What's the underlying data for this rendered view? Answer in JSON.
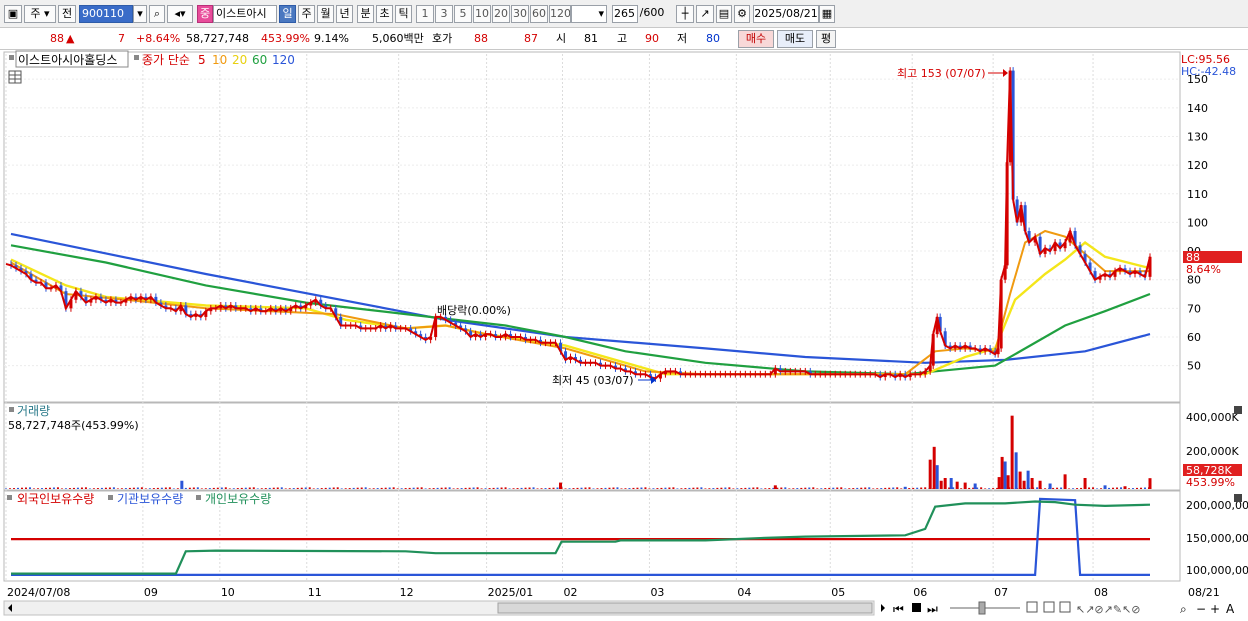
{
  "toolbar": {
    "period_type": "주",
    "prev_label": "전",
    "stock_code": "900110",
    "stock_name": "이스트아시",
    "badge": "중",
    "timeframes": [
      "일",
      "주",
      "월",
      "년",
      "분",
      "초",
      "틱"
    ],
    "selected_timeframe": "일",
    "numbers": [
      "1",
      "3",
      "5",
      "10",
      "20",
      "30",
      "60",
      "120"
    ],
    "count": "265",
    "count_max": "/600",
    "date": "2025/08/21"
  },
  "quote": {
    "price": "88",
    "change": "7",
    "change_pct": "+8.64%",
    "volume": "58,727,748",
    "volume_pct": "453.99%",
    "turnover": "9.14%",
    "amount": "5,060백만",
    "hoga_label": "호가",
    "hoga1": "88",
    "hoga2": "87",
    "open_label": "시",
    "open": "81",
    "high_label": "고",
    "high": "90",
    "low_label": "저",
    "low": "80",
    "buy_label": "매수",
    "sell_label": "매도",
    "avg_label": "평"
  },
  "price_panel": {
    "stock_label": "이스트아시아홀딩스",
    "ma_label": "종가 단순",
    "ma_periods": [
      "5",
      "10",
      "20",
      "60",
      "120"
    ],
    "ma_colors": [
      "#d40000",
      "#f09a10",
      "#f0e020",
      "#20a040",
      "#2a55d8"
    ],
    "lc": "LC:95.56",
    "hc": "HC:-42.48",
    "max_annotation": "최고 153 (07/07)",
    "min_annotation": "최저 45 (03/07)",
    "div_annotation": "배당락(0.00%)",
    "current_price": "88",
    "current_pct": "8.64%",
    "y_ticks": [
      "150",
      "140",
      "130",
      "120",
      "110",
      "100",
      "90",
      "80",
      "70",
      "60",
      "50"
    ]
  },
  "volume_panel": {
    "title": "거래량",
    "current": "58,727,748주(453.99%)",
    "y_ticks": [
      "400,000K",
      "200,000K"
    ],
    "last_value": "58,728K",
    "last_pct": "453.99%"
  },
  "holding_panel": {
    "series": [
      {
        "name": "외국인보유수량",
        "color": "#d40000"
      },
      {
        "name": "기관보유수량",
        "color": "#2a55d8"
      },
      {
        "name": "개인보유수량",
        "color": "#20905a"
      }
    ],
    "y_ticks": [
      "200,000,00",
      "150,000,00",
      "100,000,00"
    ]
  },
  "x_axis": {
    "labels": [
      "2024/07/08",
      "09",
      "10",
      "11",
      "12",
      "2025/01",
      "02",
      "03",
      "04",
      "05",
      "06",
      "07",
      "08",
      "08/21"
    ]
  },
  "chart_data": {
    "type": "line",
    "x_range": [
      "2024/07/08",
      "2025/08/21"
    ],
    "price_ylim": [
      38,
      156
    ],
    "price_close": [
      [
        0,
        85.5
      ],
      [
        5,
        85
      ],
      [
        10,
        84
      ],
      [
        15,
        83
      ],
      [
        20,
        82
      ],
      [
        25,
        80
      ],
      [
        30,
        79
      ],
      [
        35,
        79
      ],
      [
        40,
        77
      ],
      [
        45,
        77
      ],
      [
        50,
        78
      ],
      [
        55,
        76
      ],
      [
        60,
        70
      ],
      [
        65,
        73
      ],
      [
        70,
        76
      ],
      [
        75,
        74
      ],
      [
        80,
        72
      ],
      [
        85,
        73
      ],
      [
        90,
        74
      ],
      [
        95,
        73
      ],
      [
        100,
        72
      ],
      [
        105,
        73
      ],
      [
        110,
        72
      ],
      [
        115,
        72
      ],
      [
        120,
        73
      ],
      [
        125,
        74
      ],
      [
        130,
        73
      ],
      [
        135,
        74
      ],
      [
        140,
        73
      ],
      [
        145,
        74
      ],
      [
        150,
        72
      ],
      [
        155,
        71
      ],
      [
        160,
        70
      ],
      [
        165,
        70
      ],
      [
        170,
        69
      ],
      [
        175,
        71
      ],
      [
        180,
        68
      ],
      [
        185,
        67
      ],
      [
        190,
        68
      ],
      [
        195,
        67
      ],
      [
        200,
        69
      ],
      [
        205,
        70
      ],
      [
        210,
        70
      ],
      [
        215,
        71
      ],
      [
        220,
        70
      ],
      [
        225,
        71
      ],
      [
        230,
        70
      ],
      [
        235,
        70
      ],
      [
        240,
        70
      ],
      [
        245,
        69
      ],
      [
        250,
        70
      ],
      [
        255,
        69
      ],
      [
        260,
        69
      ],
      [
        265,
        70
      ],
      [
        270,
        69
      ],
      [
        275,
        70
      ],
      [
        280,
        69
      ],
      [
        285,
        70
      ],
      [
        290,
        71
      ],
      [
        295,
        70
      ],
      [
        300,
        71
      ],
      [
        305,
        72
      ],
      [
        310,
        73
      ],
      [
        315,
        71
      ],
      [
        320,
        70
      ],
      [
        325,
        70
      ],
      [
        330,
        67
      ],
      [
        335,
        64
      ],
      [
        340,
        64
      ],
      [
        345,
        64
      ],
      [
        350,
        64
      ],
      [
        355,
        63
      ],
      [
        360,
        63
      ],
      [
        365,
        63
      ],
      [
        370,
        63
      ],
      [
        375,
        64
      ],
      [
        380,
        63
      ],
      [
        385,
        64
      ],
      [
        390,
        63
      ],
      [
        395,
        63
      ],
      [
        400,
        63
      ],
      [
        405,
        62
      ],
      [
        410,
        61
      ],
      [
        415,
        60
      ],
      [
        420,
        59
      ],
      [
        425,
        60
      ],
      [
        430,
        67
      ],
      [
        435,
        67
      ],
      [
        440,
        66
      ],
      [
        445,
        65
      ],
      [
        450,
        64
      ],
      [
        455,
        63
      ],
      [
        460,
        62
      ],
      [
        465,
        60
      ],
      [
        470,
        61
      ],
      [
        475,
        60
      ],
      [
        480,
        61
      ],
      [
        485,
        61
      ],
      [
        490,
        60
      ],
      [
        495,
        60
      ],
      [
        500,
        61
      ],
      [
        505,
        60
      ],
      [
        510,
        60
      ],
      [
        515,
        60
      ],
      [
        520,
        59
      ],
      [
        525,
        59
      ],
      [
        530,
        59
      ],
      [
        535,
        58
      ],
      [
        540,
        58
      ],
      [
        545,
        58
      ],
      [
        550,
        58
      ],
      [
        555,
        55
      ],
      [
        560,
        52
      ],
      [
        565,
        53
      ],
      [
        570,
        52
      ],
      [
        575,
        51
      ],
      [
        580,
        51
      ],
      [
        585,
        51
      ],
      [
        590,
        51
      ],
      [
        595,
        50
      ],
      [
        600,
        50
      ],
      [
        605,
        50
      ],
      [
        610,
        49
      ],
      [
        615,
        49
      ],
      [
        620,
        48
      ],
      [
        625,
        48
      ],
      [
        630,
        47
      ],
      [
        635,
        47
      ],
      [
        640,
        47
      ],
      [
        645,
        46
      ],
      [
        650,
        45.5
      ],
      [
        655,
        47
      ],
      [
        660,
        48
      ],
      [
        665,
        48
      ],
      [
        670,
        48
      ],
      [
        675,
        47
      ],
      [
        680,
        47
      ],
      [
        685,
        47
      ],
      [
        690,
        47
      ],
      [
        695,
        47
      ],
      [
        700,
        47
      ],
      [
        705,
        47
      ],
      [
        710,
        47
      ],
      [
        715,
        47
      ],
      [
        720,
        47
      ],
      [
        725,
        47
      ],
      [
        730,
        47
      ],
      [
        735,
        47
      ],
      [
        740,
        47
      ],
      [
        745,
        47
      ],
      [
        750,
        47
      ],
      [
        755,
        47
      ],
      [
        760,
        47
      ],
      [
        765,
        47
      ],
      [
        770,
        49
      ],
      [
        775,
        48
      ],
      [
        780,
        48
      ],
      [
        785,
        48
      ],
      [
        790,
        48
      ],
      [
        795,
        48
      ],
      [
        800,
        48
      ],
      [
        805,
        47
      ],
      [
        810,
        47
      ],
      [
        815,
        47
      ],
      [
        820,
        47
      ],
      [
        825,
        47
      ],
      [
        830,
        47
      ],
      [
        835,
        47
      ],
      [
        840,
        47
      ],
      [
        845,
        47
      ],
      [
        850,
        47
      ],
      [
        855,
        47
      ],
      [
        860,
        47
      ],
      [
        865,
        47
      ],
      [
        870,
        47
      ],
      [
        875,
        46
      ],
      [
        880,
        47
      ],
      [
        885,
        47
      ],
      [
        890,
        46
      ],
      [
        895,
        47
      ],
      [
        900,
        46
      ],
      [
        905,
        47
      ],
      [
        910,
        47
      ],
      [
        915,
        47
      ],
      [
        920,
        48
      ],
      [
        925,
        50
      ],
      [
        928,
        61
      ],
      [
        932,
        67
      ],
      [
        935,
        62
      ],
      [
        940,
        57
      ],
      [
        945,
        56
      ],
      [
        950,
        57
      ],
      [
        955,
        56
      ],
      [
        960,
        57
      ],
      [
        965,
        56
      ],
      [
        970,
        56
      ],
      [
        975,
        55
      ],
      [
        980,
        56
      ],
      [
        985,
        55
      ],
      [
        990,
        54
      ],
      [
        993,
        56
      ],
      [
        996,
        80
      ],
      [
        1000,
        85
      ],
      [
        1002,
        121
      ],
      [
        1005,
        153
      ],
      [
        1008,
        108
      ],
      [
        1012,
        100
      ],
      [
        1016,
        106
      ],
      [
        1020,
        97
      ],
      [
        1024,
        93
      ],
      [
        1030,
        95
      ],
      [
        1035,
        89
      ],
      [
        1040,
        91
      ],
      [
        1045,
        90
      ],
      [
        1050,
        93
      ],
      [
        1055,
        91
      ],
      [
        1060,
        93
      ],
      [
        1065,
        97
      ],
      [
        1070,
        92
      ],
      [
        1075,
        89
      ],
      [
        1080,
        86
      ],
      [
        1085,
        83
      ],
      [
        1090,
        80
      ],
      [
        1095,
        81
      ],
      [
        1100,
        82
      ],
      [
        1105,
        81
      ],
      [
        1110,
        83
      ],
      [
        1115,
        84
      ],
      [
        1120,
        83
      ],
      [
        1125,
        82
      ],
      [
        1130,
        83
      ],
      [
        1135,
        82
      ],
      [
        1140,
        81
      ],
      [
        1145,
        88
      ]
    ],
    "ma120": [
      [
        5,
        96
      ],
      [
        200,
        82
      ],
      [
        440,
        66
      ],
      [
        560,
        60
      ],
      [
        700,
        56
      ],
      [
        800,
        53
      ],
      [
        920,
        51
      ],
      [
        1000,
        52
      ],
      [
        1080,
        55
      ],
      [
        1145,
        61
      ]
    ],
    "ma60": [
      [
        5,
        92
      ],
      [
        100,
        86
      ],
      [
        200,
        78
      ],
      [
        300,
        72
      ],
      [
        400,
        68
      ],
      [
        500,
        64
      ],
      [
        560,
        60
      ],
      [
        620,
        55
      ],
      [
        700,
        51
      ],
      [
        800,
        48
      ],
      [
        900,
        47
      ],
      [
        990,
        50
      ],
      [
        1010,
        54
      ],
      [
        1060,
        64
      ],
      [
        1100,
        69
      ],
      [
        1145,
        75
      ]
    ],
    "ma20": [
      [
        5,
        87
      ],
      [
        60,
        78
      ],
      [
        100,
        74
      ],
      [
        200,
        71
      ],
      [
        300,
        70
      ],
      [
        340,
        66
      ],
      [
        400,
        63
      ],
      [
        440,
        64
      ],
      [
        480,
        61
      ],
      [
        560,
        57
      ],
      [
        620,
        51
      ],
      [
        660,
        47
      ],
      [
        800,
        47
      ],
      [
        920,
        47
      ],
      [
        960,
        53
      ],
      [
        990,
        56
      ],
      [
        1010,
        73
      ],
      [
        1040,
        82
      ],
      [
        1060,
        87
      ],
      [
        1080,
        93
      ],
      [
        1100,
        88
      ],
      [
        1145,
        84
      ]
    ],
    "ma10": [
      [
        5,
        86
      ],
      [
        60,
        75
      ],
      [
        120,
        73
      ],
      [
        200,
        70
      ],
      [
        330,
        68
      ],
      [
        400,
        63
      ],
      [
        440,
        64
      ],
      [
        480,
        61
      ],
      [
        560,
        56
      ],
      [
        640,
        48
      ],
      [
        700,
        47
      ],
      [
        900,
        47
      ],
      [
        930,
        55
      ],
      [
        960,
        56
      ],
      [
        990,
        55
      ],
      [
        1005,
        75
      ],
      [
        1020,
        93
      ],
      [
        1040,
        97
      ],
      [
        1060,
        95
      ],
      [
        1080,
        89
      ],
      [
        1100,
        83
      ],
      [
        1145,
        83
      ]
    ],
    "volume_k": [
      [
        176,
        45
      ],
      [
        555,
        35
      ],
      [
        770,
        20
      ],
      [
        900,
        12
      ],
      [
        925,
        160
      ],
      [
        929,
        230
      ],
      [
        932,
        130
      ],
      [
        936,
        45
      ],
      [
        940,
        60
      ],
      [
        946,
        60
      ],
      [
        952,
        40
      ],
      [
        960,
        35
      ],
      [
        970,
        30
      ],
      [
        994,
        65
      ],
      [
        997,
        175
      ],
      [
        1000,
        150
      ],
      [
        1003,
        75
      ],
      [
        1007,
        400
      ],
      [
        1011,
        200
      ],
      [
        1015,
        95
      ],
      [
        1019,
        45
      ],
      [
        1023,
        100
      ],
      [
        1027,
        60
      ],
      [
        1035,
        45
      ],
      [
        1045,
        30
      ],
      [
        1060,
        80
      ],
      [
        1080,
        60
      ],
      [
        1100,
        20
      ],
      [
        1120,
        15
      ],
      [
        1145,
        59
      ]
    ],
    "holding_ylim": [
      80,
      210
    ],
    "foreign": [
      [
        5,
        144
      ],
      [
        1145,
        144
      ]
    ],
    "institution": [
      [
        5,
        88
      ],
      [
        1030,
        88
      ],
      [
        1035,
        207
      ],
      [
        1070,
        205
      ],
      [
        1075,
        88
      ],
      [
        1145,
        88
      ]
    ],
    "individual": [
      [
        5,
        90
      ],
      [
        170,
        90
      ],
      [
        180,
        125
      ],
      [
        210,
        126
      ],
      [
        400,
        125
      ],
      [
        430,
        122
      ],
      [
        550,
        122
      ],
      [
        556,
        140
      ],
      [
        610,
        140
      ],
      [
        615,
        142
      ],
      [
        700,
        142
      ],
      [
        760,
        146
      ],
      [
        800,
        148
      ],
      [
        900,
        150
      ],
      [
        920,
        160
      ],
      [
        930,
        195
      ],
      [
        960,
        200
      ],
      [
        1000,
        200
      ],
      [
        1030,
        203
      ],
      [
        1050,
        202
      ],
      [
        1070,
        198
      ],
      [
        1100,
        196
      ],
      [
        1145,
        198
      ]
    ]
  }
}
